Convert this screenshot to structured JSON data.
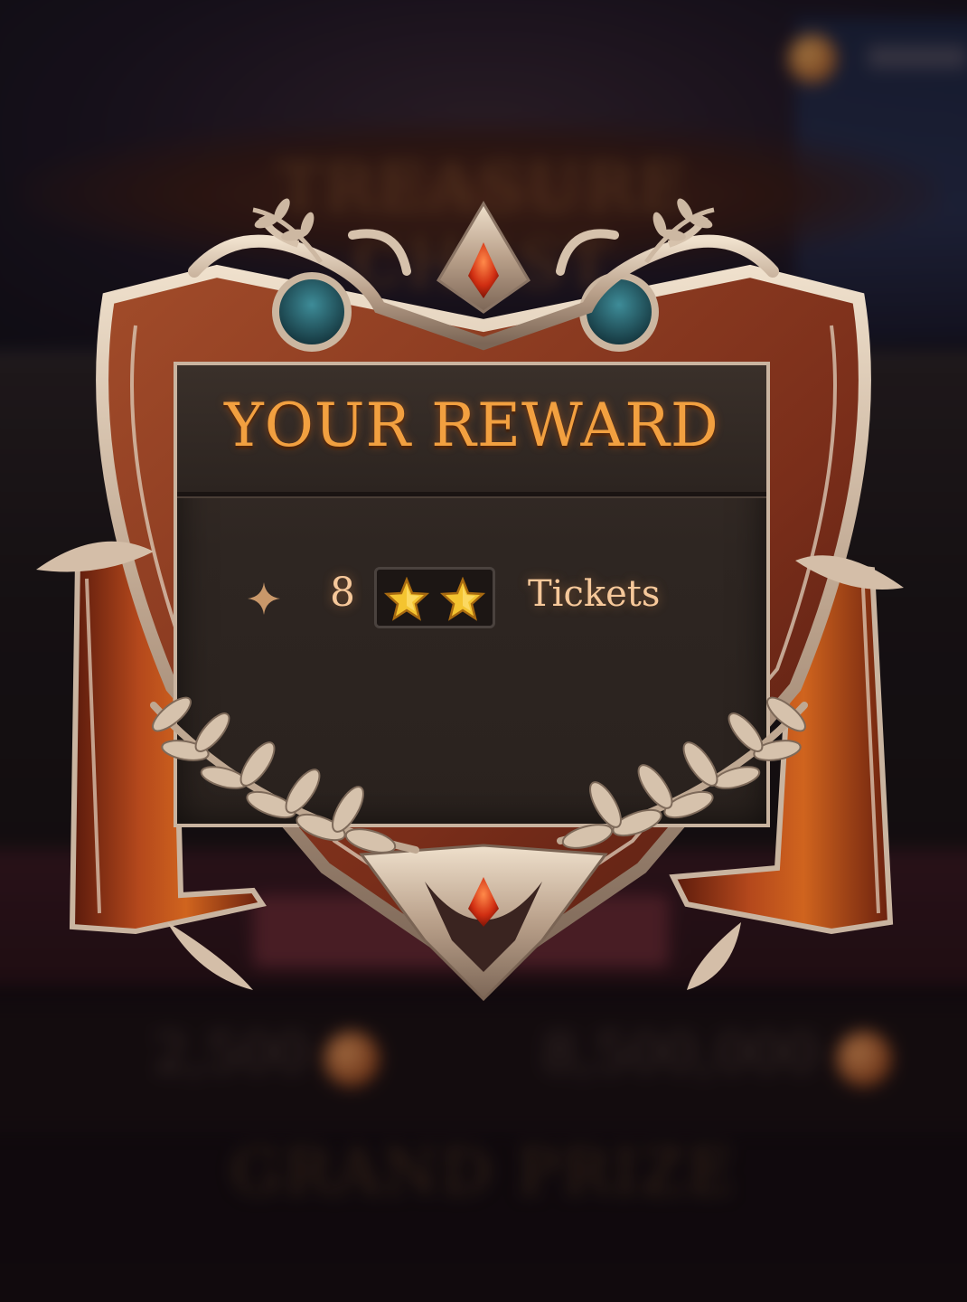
{
  "background": {
    "title_text": "TREASURE CHEST",
    "stat_left_value": "2,500",
    "stat_right_value": "8,500,000",
    "grand_prize_text": "GRAND PRIZE"
  },
  "reward_panel": {
    "title": "YOUR REWARD",
    "reward": {
      "amount": "8",
      "stars": 2,
      "label": "Tickets"
    }
  },
  "colors": {
    "title_orange": "#f2a040",
    "reward_text": "#f6c89a",
    "panel_bg": "#2e2622",
    "frame_silver": "#c9b4a0",
    "frame_copper": "#8a3a22",
    "banner_red": "#a8401a",
    "gem_red": "#d8401e",
    "gem_teal": "#2a6a78",
    "star_gold": "#f4c430"
  },
  "icons": [
    "sparkle-icon",
    "star-icon",
    "laurel-icon",
    "gem-icon"
  ]
}
